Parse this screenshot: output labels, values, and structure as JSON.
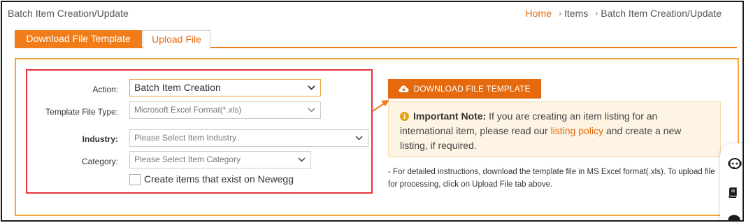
{
  "header": {
    "title": "Batch Item Creation/Update"
  },
  "breadcrumb": {
    "items": [
      "Home",
      "Items",
      "Batch Item Creation/Update"
    ]
  },
  "tabs": [
    {
      "label": "Download File Template",
      "active": true
    },
    {
      "label": "Upload File",
      "active": false
    }
  ],
  "form": {
    "action_label": "Action:",
    "action_value": "Batch Item Creation",
    "template_type_label": "Template File Type:",
    "template_type_value": "Microsoft Excel Format(*.xls)",
    "industry_label": "Industry:",
    "industry_placeholder": "Please Select Item Industry",
    "category_label": "Category:",
    "category_placeholder": "Please Select Item Category",
    "checkbox_label": "Create items that exist on Newegg",
    "checkbox_checked": false
  },
  "download_button": {
    "label": "DOWNLOAD FILE TEMPLATE",
    "icon": "cloud-download-icon"
  },
  "note": {
    "heading": "Important Note:",
    "text_before_link": "If you are creating an item listing for an international item, please read our",
    "link_text": "listing policy",
    "text_after_link": "and create a new listing, if required."
  },
  "instructions": {
    "text": "- For detailed instructions, download the template file in MS Excel format(.xls). To upload file for processing, click on Upload File tab above."
  },
  "colors": {
    "accent": "#e5690d",
    "tab_active": "#f07d1a",
    "panel_border": "#f2a33a",
    "highlight_box": "#e8323c",
    "note_bg": "#fdf4e3"
  },
  "side_tools": [
    "chat-bot-icon",
    "book-icon",
    "chat-bubble-icon"
  ]
}
